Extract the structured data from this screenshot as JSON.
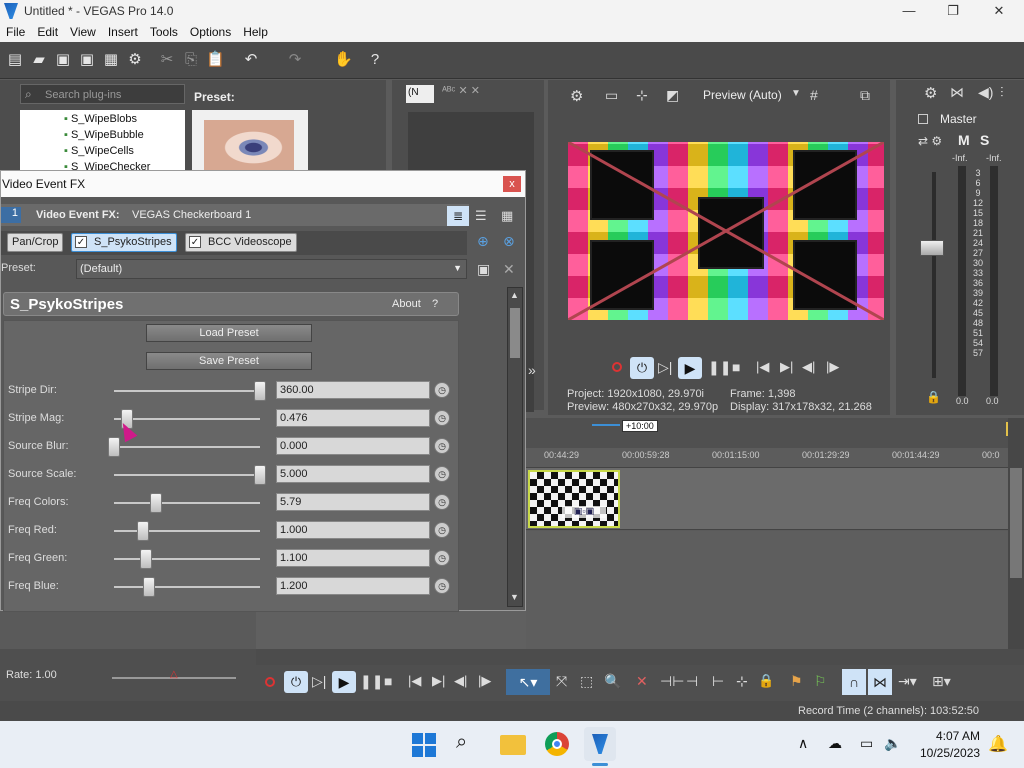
{
  "window": {
    "title": "Untitled * - VEGAS Pro 14.0",
    "min": "—",
    "max": "❐",
    "close": "✕"
  },
  "menu": [
    "File",
    "Edit",
    "View",
    "Insert",
    "Tools",
    "Options",
    "Help"
  ],
  "plugin_browser": {
    "search_placeholder": "Search plug-ins",
    "preset_label": "Preset:",
    "items": [
      "S_WipeBlobs",
      "S_WipeBubble",
      "S_WipeCells",
      "S_WipeChecker"
    ]
  },
  "preview": {
    "mode": "Preview (Auto)",
    "dropdown_small": "(N",
    "project_label": "Project:",
    "project_value": "1920x1080, 29.970i",
    "preview_label": "Preview:",
    "preview_value": "480x270x32, 29.970p",
    "frame_label": "Frame:",
    "frame_value": "1,398",
    "display_label": "Display:",
    "display_value": "317x178x32, 21.268"
  },
  "master": {
    "label": "Master",
    "m": "M",
    "s": "S",
    "inf_left": "-Inf.",
    "inf_right": "-Inf.",
    "scale": [
      "3",
      "6",
      "9",
      "12",
      "15",
      "18",
      "21",
      "24",
      "27",
      "30",
      "33",
      "36",
      "39",
      "42",
      "45",
      "48",
      "51",
      "54",
      "57"
    ],
    "bottom_left": "0.0",
    "bottom_right": "0.0"
  },
  "dialog": {
    "title": "Video Event FX",
    "close": "x",
    "track_num": "1",
    "event_label": "Video Event FX:",
    "event_value": "VEGAS Checkerboard 1",
    "chain": [
      "Pan/Crop",
      "S_PsykoStripes",
      "BCC Videoscope"
    ],
    "preset_label": "Preset:",
    "preset_value": "(Default)",
    "plugin_name": "S_PsykoStripes",
    "about": "About",
    "help": "?",
    "load_preset": "Load Preset",
    "save_preset": "Save Preset",
    "params": [
      {
        "label": "Stripe Dir:",
        "value": "360.00",
        "level": 1.0
      },
      {
        "label": "Stripe Mag:",
        "value": "0.476",
        "level": 0.09
      },
      {
        "label": "Source Blur:",
        "value": "0.000",
        "level": 0.0
      },
      {
        "label": "Source Scale:",
        "value": "5.000",
        "level": 1.0
      },
      {
        "label": "Freq Colors:",
        "value": "5.79",
        "level": 0.29
      },
      {
        "label": "Freq Red:",
        "value": "1.000",
        "level": 0.2
      },
      {
        "label": "Freq Green:",
        "value": "1.100",
        "level": 0.22
      },
      {
        "label": "Freq Blue:",
        "value": "1.200",
        "level": 0.24
      }
    ]
  },
  "timeline": {
    "offset": "+10:00",
    "ticks": [
      "00:44:29",
      "00:00:59:28",
      "00:01:15:00",
      "00:01:29:29",
      "00:01:44:29",
      "00:0"
    ],
    "rate_label": "Rate: 1.00"
  },
  "status": {
    "record_time": "Record Time (2 channels): 103:52:50"
  },
  "taskbar": {
    "time": "4:07 AM",
    "date": "10/25/2023"
  },
  "colors": {
    "accent": "#3c8fd6",
    "red_close": "#d9534f",
    "checker_border": "#c8d94a"
  }
}
